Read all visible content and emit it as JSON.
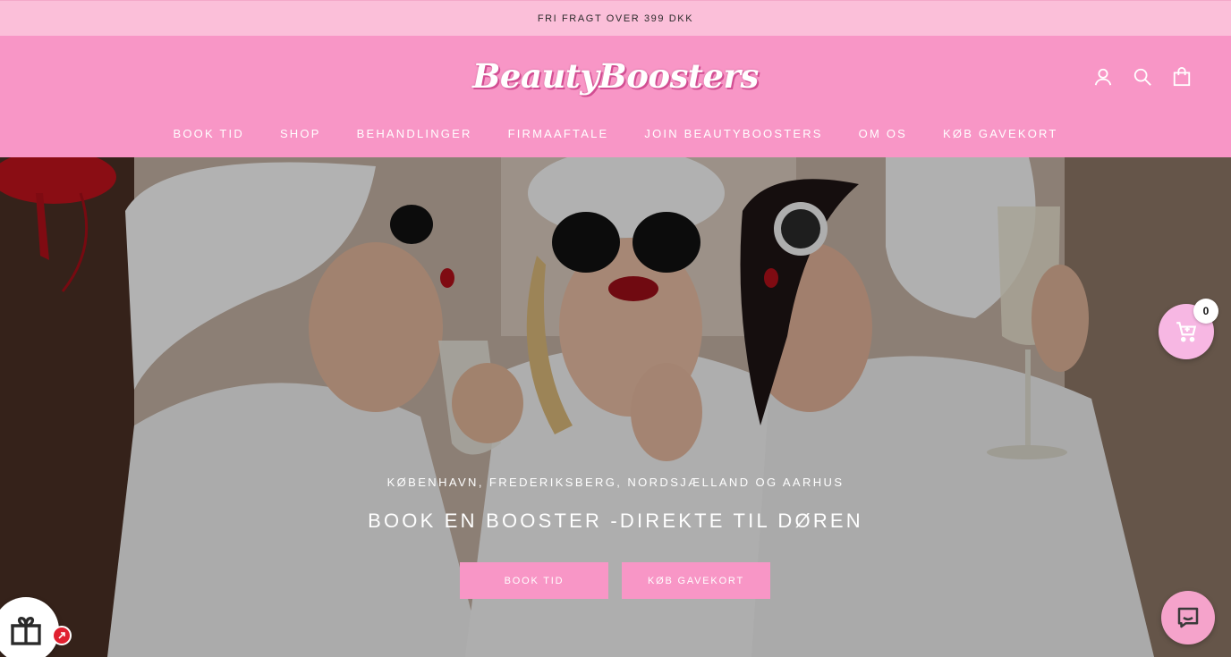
{
  "announcement": {
    "text": "FRI FRAGT OVER 399 DKK"
  },
  "brand": {
    "logo_text": "BeautyBoosters"
  },
  "header": {
    "icons": [
      "account-icon",
      "search-icon",
      "shopping-bag-icon"
    ]
  },
  "nav": {
    "items": [
      {
        "label": "BOOK TID"
      },
      {
        "label": "SHOP"
      },
      {
        "label": "BEHANDLINGER"
      },
      {
        "label": "FIRMAAFTALE"
      },
      {
        "label": "JOIN BEAUTYBOOSTERS"
      },
      {
        "label": "OM OS"
      },
      {
        "label": "KØB GAVEKORT"
      }
    ]
  },
  "hero": {
    "subtitle": "KØBENHAVN, FREDERIKSBERG, NORDSJÆLLAND OG AARHUS",
    "title": "BOOK EN BOOSTER -DIREKTE TIL DØREN",
    "primary_button": "BOOK TID",
    "secondary_button": "KØB GAVEKORT"
  },
  "floating": {
    "cart_count": "0",
    "cart_icon": "cart-icon",
    "chat_icon": "chat-icon",
    "gift_icon": "gift-icon"
  },
  "colors": {
    "brand_pink": "#f896c6",
    "announcement_bg": "#fbbfd9",
    "cart_bubble": "#f7b7e3",
    "badge_red": "#e02030"
  }
}
